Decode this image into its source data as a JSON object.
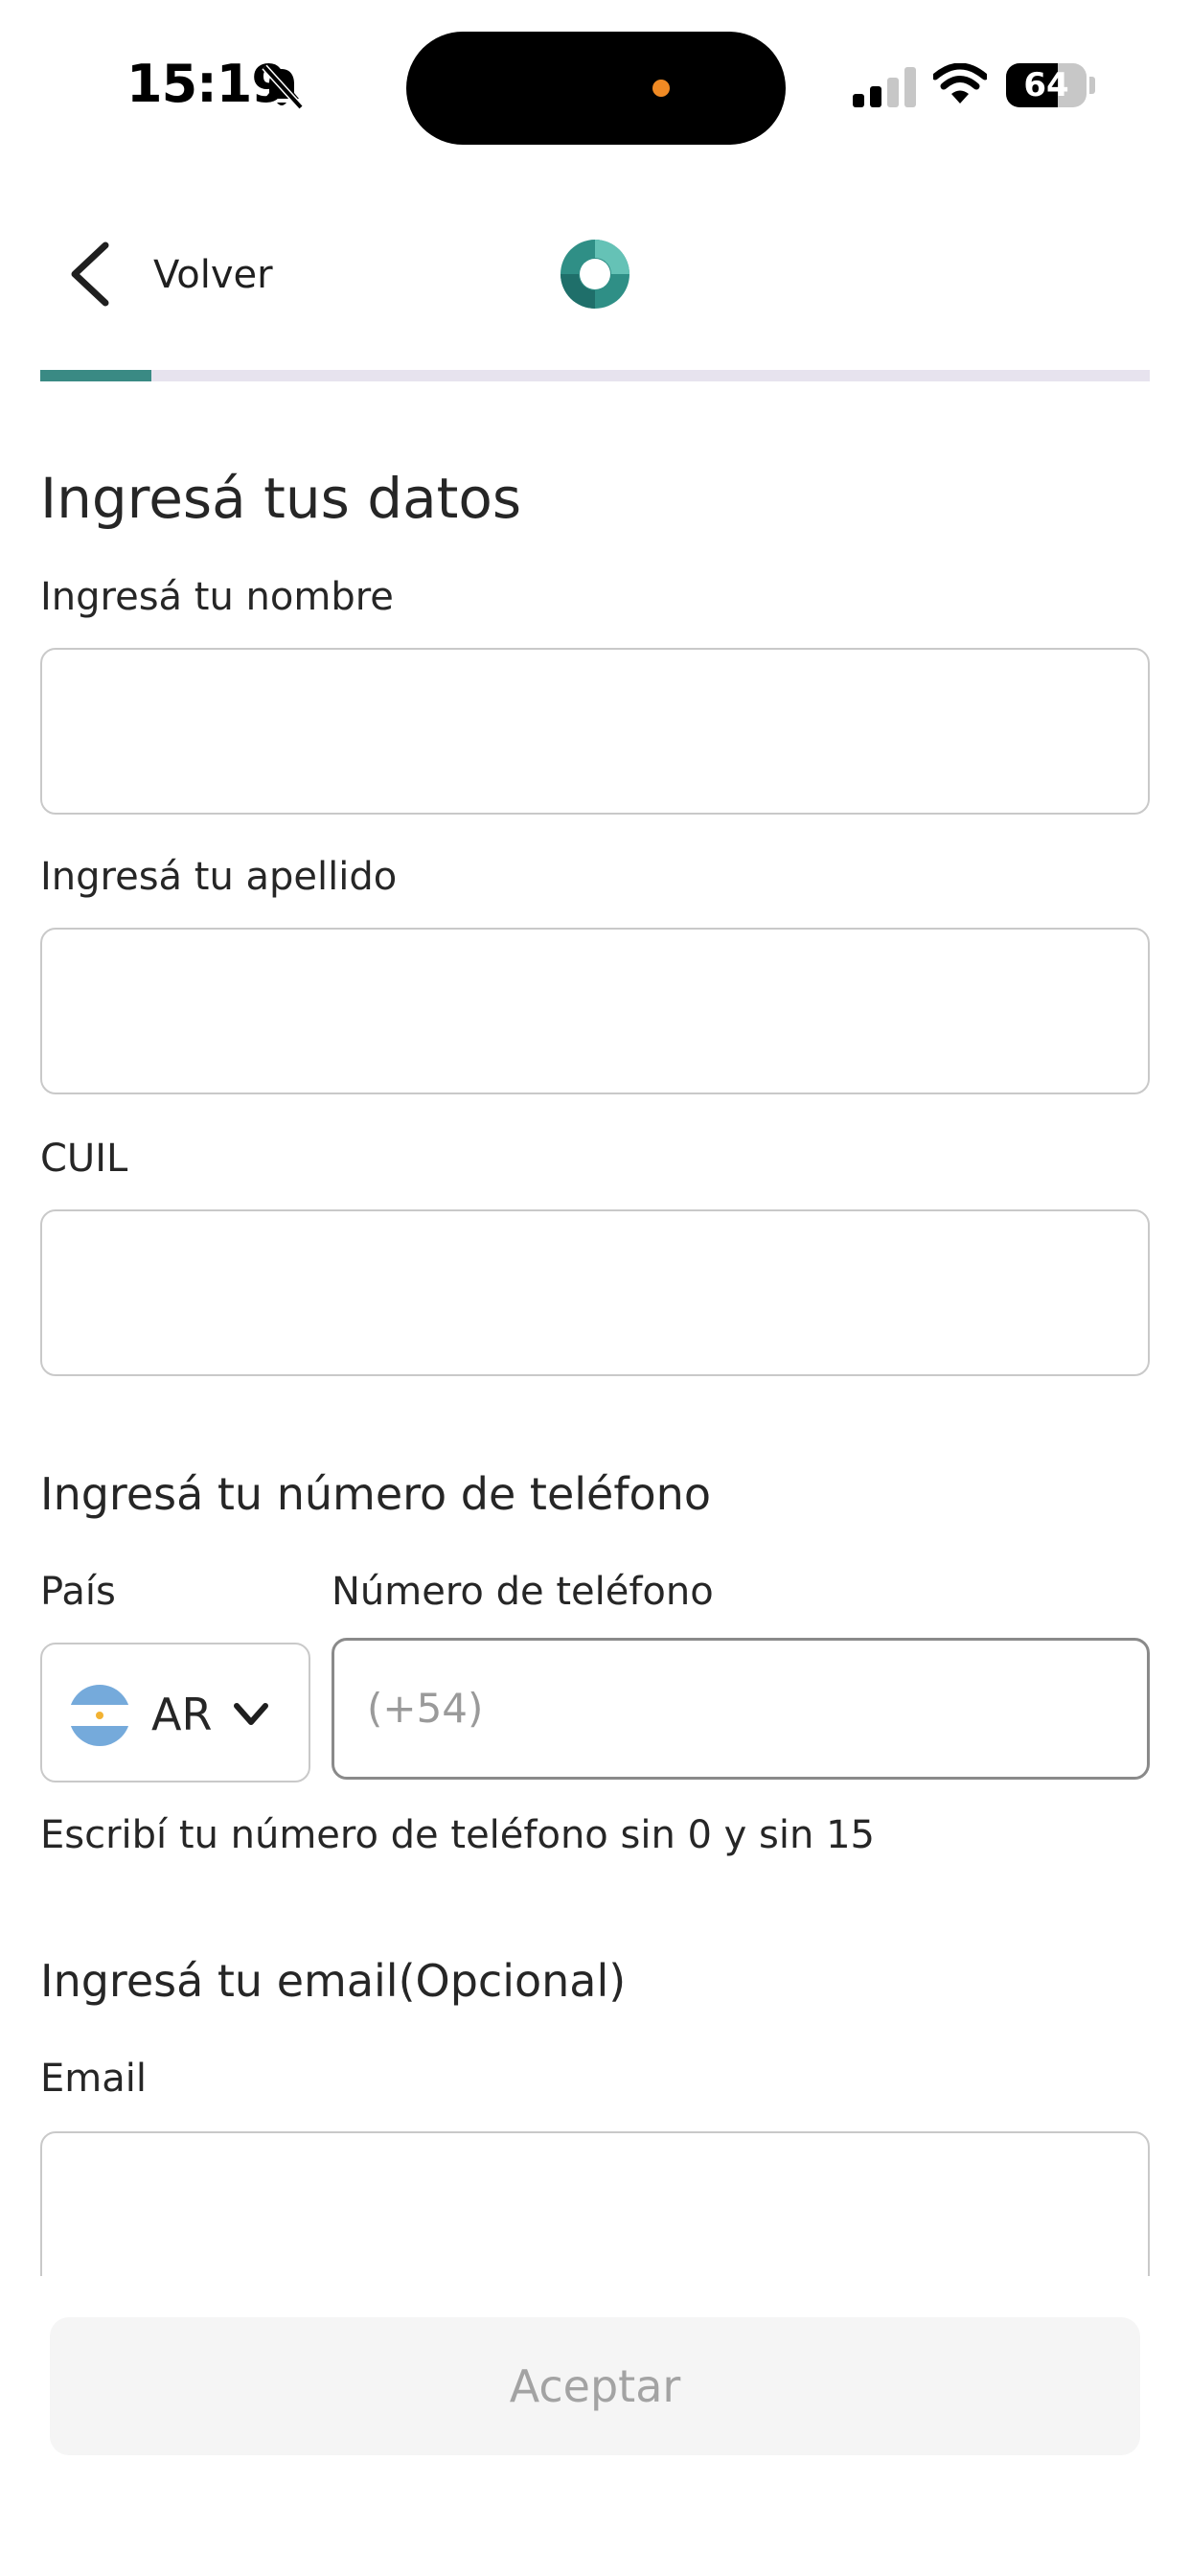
{
  "status_bar": {
    "time": "15:19",
    "battery_level": "64",
    "battery_fraction": 0.64,
    "icons": [
      "bell-muted-icon",
      "signal-icon",
      "wifi-icon",
      "battery-icon"
    ]
  },
  "nav": {
    "back_label": "Volver",
    "icons": [
      "chevron-left-icon",
      "app-logo"
    ]
  },
  "progress": {
    "fraction": 0.1,
    "fill_color": "#3a8a84",
    "track_color": "#e7e3ee"
  },
  "form": {
    "title": "Ingresá tus datos",
    "first_name_label": "Ingresá tu nombre",
    "first_name_value": "",
    "last_name_label": "Ingresá tu apellido",
    "last_name_value": "",
    "cuil_label": "CUIL",
    "cuil_value": "",
    "phone_section_title": "Ingresá tu número de teléfono",
    "country_label": "País",
    "country_code": "AR",
    "phone_label": "Número de teléfono",
    "phone_placeholder": "(+54)",
    "phone_helper": "Escribí tu número de teléfono sin 0 y sin 15",
    "email_section_title": "Ingresá tu email(Opcional)",
    "email_label": "Email",
    "email_value": ""
  },
  "footer": {
    "accept_label": "Aceptar"
  }
}
